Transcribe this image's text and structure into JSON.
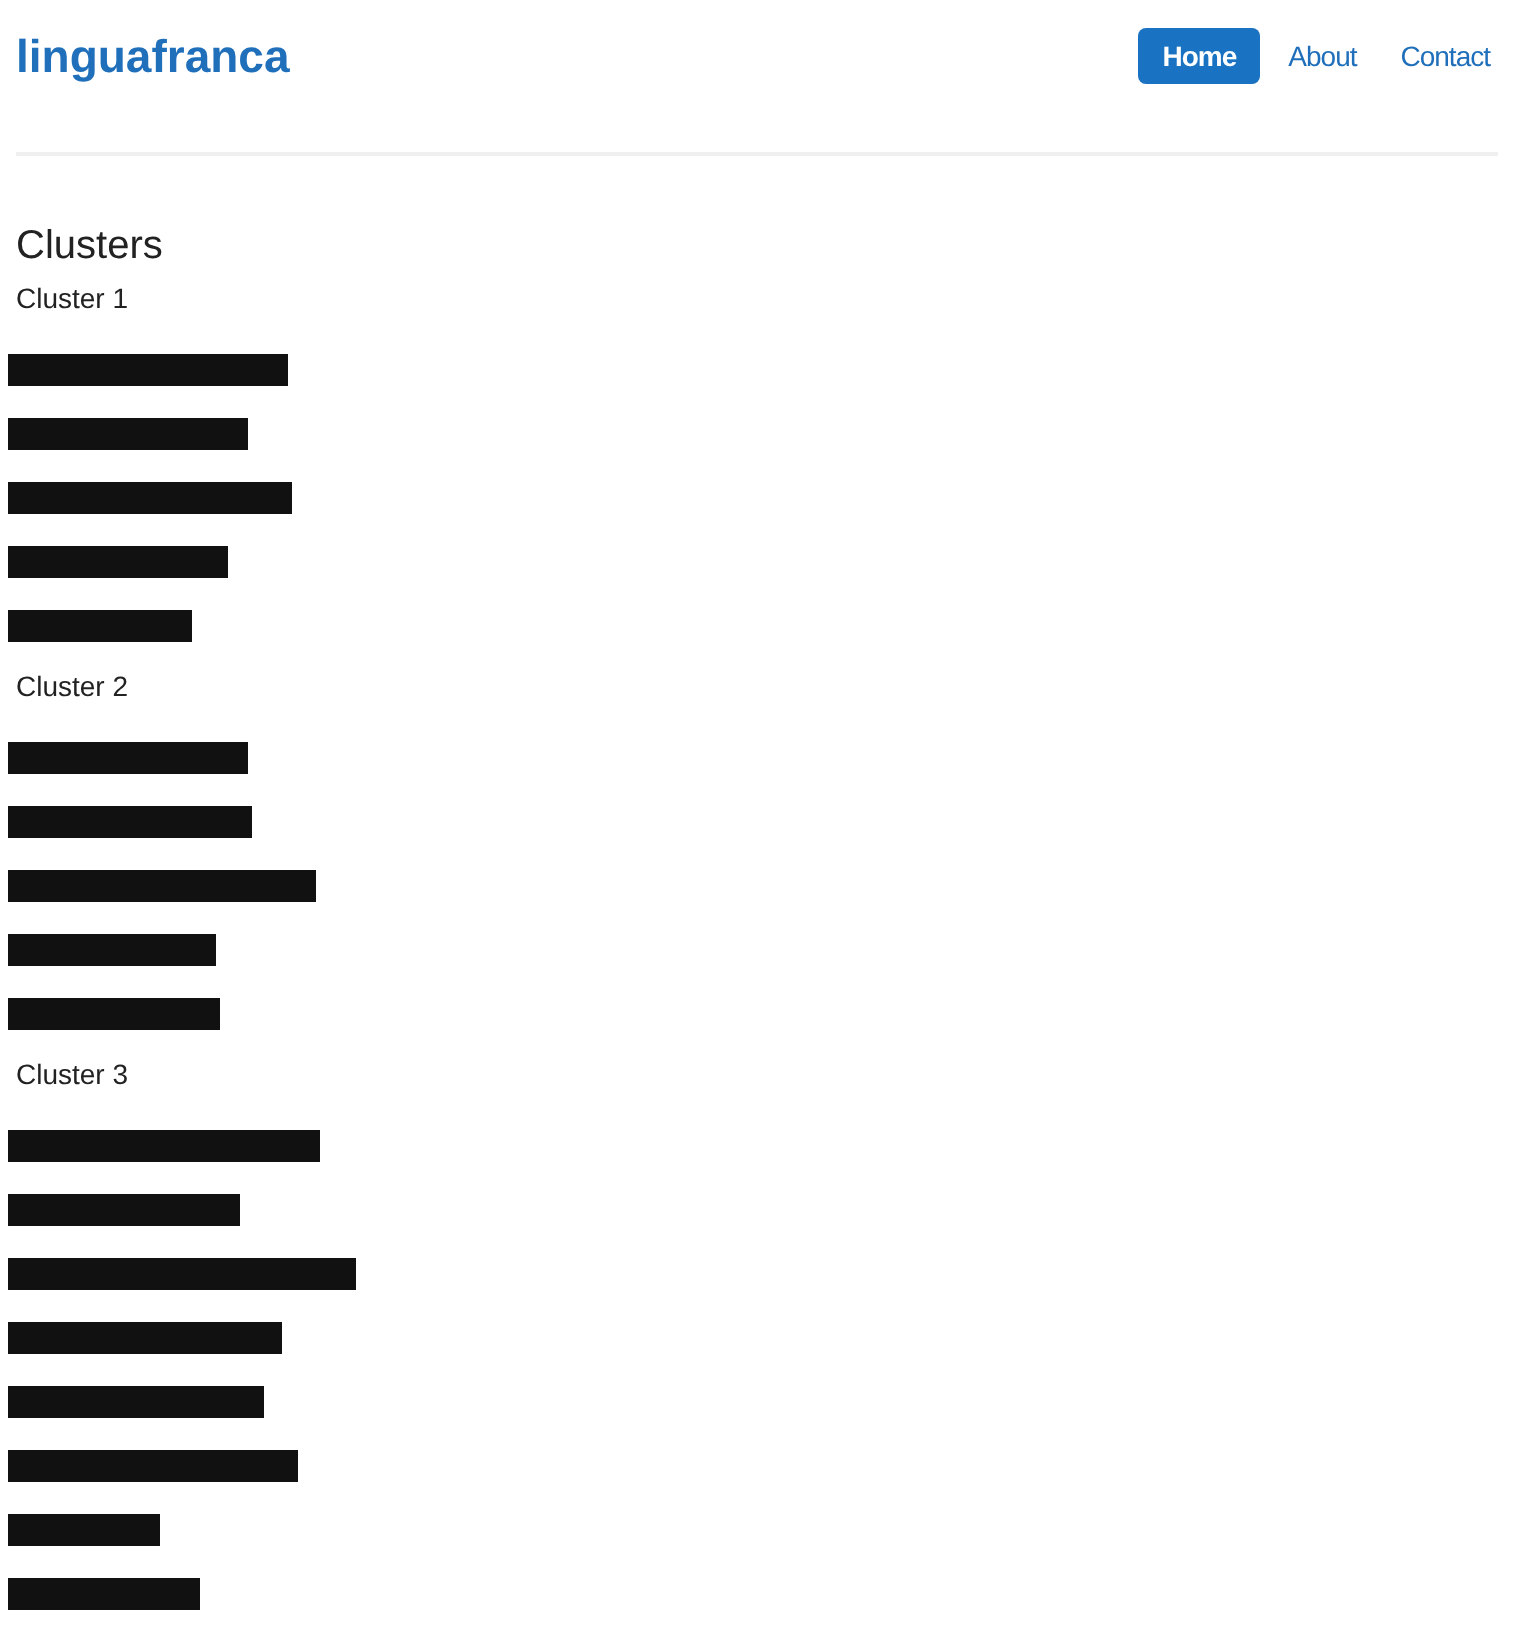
{
  "brand": "linguafranca",
  "nav": [
    {
      "label": "Home",
      "selected": true
    },
    {
      "label": "About",
      "selected": false
    },
    {
      "label": "Contact",
      "selected": false
    }
  ],
  "heading": "Clusters",
  "clusters": [
    {
      "title": "Cluster 1",
      "items": [
        {
          "kind": "redacted"
        },
        {
          "kind": "redacted"
        },
        {
          "kind": "redacted"
        },
        {
          "kind": "redacted"
        },
        {
          "kind": "redacted"
        }
      ]
    },
    {
      "title": "Cluster 2",
      "items": [
        {
          "kind": "redacted"
        },
        {
          "kind": "redacted"
        },
        {
          "kind": "redacted"
        },
        {
          "kind": "redacted"
        },
        {
          "kind": "redacted"
        }
      ]
    },
    {
      "title": "Cluster 3",
      "items": [
        {
          "kind": "redacted"
        },
        {
          "kind": "redacted"
        },
        {
          "kind": "redacted"
        },
        {
          "kind": "redacted"
        },
        {
          "kind": "redacted"
        },
        {
          "kind": "redacted"
        },
        {
          "kind": "redacted"
        },
        {
          "kind": "redacted"
        }
      ]
    }
  ]
}
